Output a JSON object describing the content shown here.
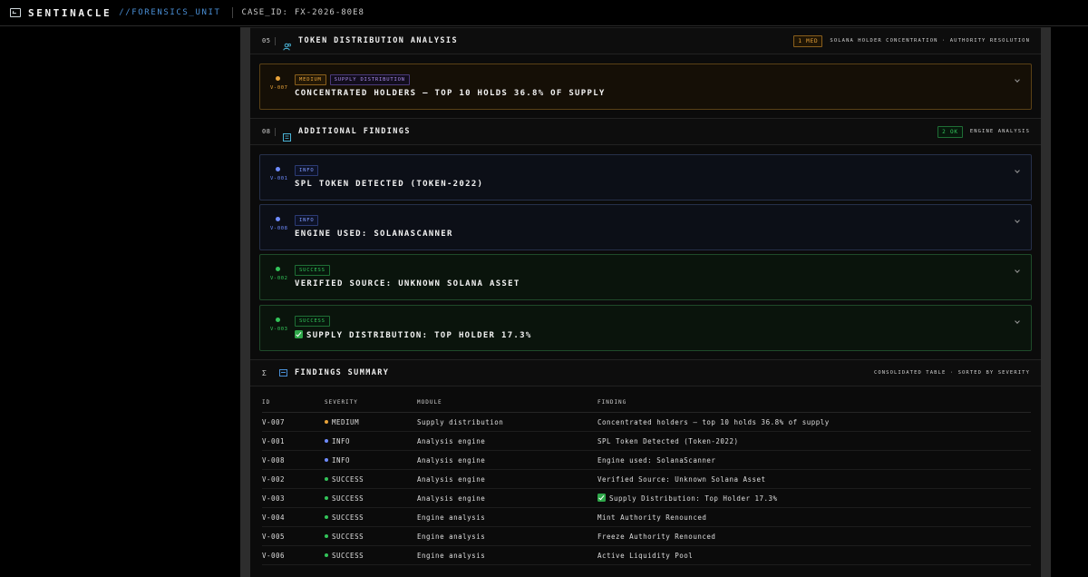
{
  "header": {
    "brand": "SENTINACLE",
    "brand_sub": "//FORENSICS_UNIT",
    "case_label": "CASE_ID:",
    "case_id": "FX-2026-80E8"
  },
  "colors": {
    "medium": "#e8a33a",
    "info": "#6f8cff",
    "success": "#33c45a",
    "accent": "#4a8fd6"
  },
  "sections": [
    {
      "num": "05",
      "title": "TOKEN DISTRIBUTION ANALYSIS",
      "icon": "users-icon",
      "count_badge": "1 MED",
      "note": "SOLANA HOLDER CONCENTRATION · AUTHORITY RESOLUTION"
    },
    {
      "num": "08",
      "title": "ADDITIONAL FINDINGS",
      "icon": "list-icon",
      "count_badge": "2 OK",
      "note": "ENGINE ANALYSIS"
    }
  ],
  "cards": [
    {
      "id": "V-007",
      "severity": "MEDIUM",
      "module_tag": "SUPPLY DISTRIBUTION",
      "title": "CONCENTRATED HOLDERS — TOP 10 HOLDS 36.8% OF SUPPLY"
    },
    {
      "id": "V-001",
      "severity": "INFO",
      "title": "SPL TOKEN DETECTED (TOKEN-2022)"
    },
    {
      "id": "V-008",
      "severity": "INFO",
      "title": "ENGINE USED: SOLANASCANNER"
    },
    {
      "id": "V-002",
      "severity": "SUCCESS",
      "title": "VERIFIED SOURCE: UNKNOWN SOLANA ASSET"
    },
    {
      "id": "V-003",
      "severity": "SUCCESS",
      "title": "SUPPLY DISTRIBUTION: TOP HOLDER 17.3%",
      "check": true
    }
  ],
  "summary": {
    "num": "Σ",
    "title": "FINDINGS SUMMARY",
    "note": "CONSOLIDATED TABLE · SORTED BY SEVERITY",
    "columns": [
      "ID",
      "SEVERITY",
      "MODULE",
      "FINDING"
    ],
    "rows": [
      {
        "id": "V-007",
        "severity": "MEDIUM",
        "module": "Supply distribution",
        "finding": "Concentrated holders — top 10 holds 36.8% of supply"
      },
      {
        "id": "V-001",
        "severity": "INFO",
        "module": "Analysis engine",
        "finding": "SPL Token Detected (Token-2022)"
      },
      {
        "id": "V-008",
        "severity": "INFO",
        "module": "Analysis engine",
        "finding": "Engine used: SolanaScanner"
      },
      {
        "id": "V-002",
        "severity": "SUCCESS",
        "module": "Analysis engine",
        "finding": "Verified Source: Unknown Solana Asset"
      },
      {
        "id": "V-003",
        "severity": "SUCCESS",
        "module": "Analysis engine",
        "finding": "Supply Distribution: Top Holder 17.3%",
        "check": true
      },
      {
        "id": "V-004",
        "severity": "SUCCESS",
        "module": "Engine analysis",
        "finding": "Mint Authority Renounced"
      },
      {
        "id": "V-005",
        "severity": "SUCCESS",
        "module": "Engine analysis",
        "finding": "Freeze Authority Renounced"
      },
      {
        "id": "V-006",
        "severity": "SUCCESS",
        "module": "Engine analysis",
        "finding": "Active Liquidity Pool"
      }
    ]
  }
}
